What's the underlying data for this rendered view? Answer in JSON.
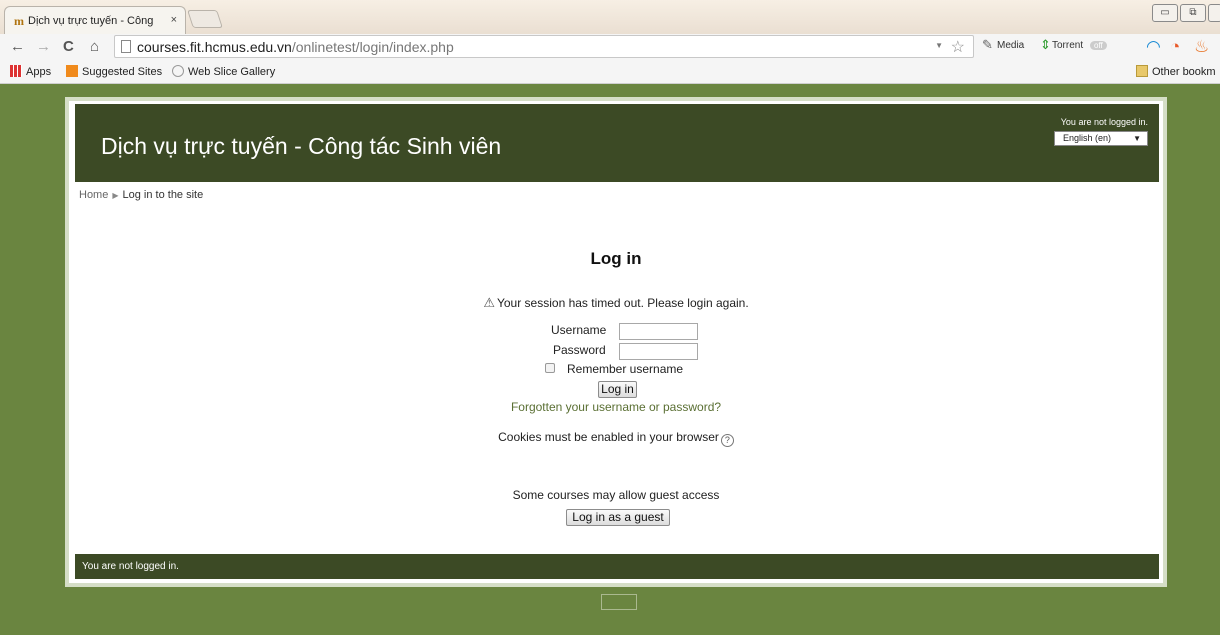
{
  "browser": {
    "tab_title": "Dịch vụ trực tuyến - Công",
    "tab_close": "×",
    "url_host": "courses.fit.hcmus.edu.vn",
    "url_path": "/onlinetest/login/index.php",
    "extensions": {
      "media": "Media",
      "torrent": "Torrent",
      "torrent_badge": "off"
    },
    "bookmarks": {
      "apps": "Apps",
      "suggested": "Suggested Sites",
      "web_slice": "Web Slice Gallery",
      "other": "Other bookm"
    }
  },
  "header": {
    "site_title": "Dịch vụ trực tuyến - Công tác Sinh viên",
    "login_info": "You are not logged in.",
    "language": "English (en)"
  },
  "breadcrumb": {
    "home": "Home",
    "current": "Log in to the site"
  },
  "login": {
    "heading": "Log in",
    "session_message": "Your session has timed out. Please login again.",
    "username_label": "Username",
    "password_label": "Password",
    "remember_label": "Remember username",
    "login_button": "Log in",
    "forgot_link": "Forgotten your username or password?",
    "cookies_text": "Cookies must be enabled in your browser",
    "guest_text": "Some courses may allow guest access",
    "guest_button": "Log in as a guest"
  },
  "footer": {
    "login_info": "You are not logged in."
  },
  "colors": {
    "header_bg": "#3c4a25",
    "page_bg": "#6a8540",
    "link": "#5a6f33"
  }
}
